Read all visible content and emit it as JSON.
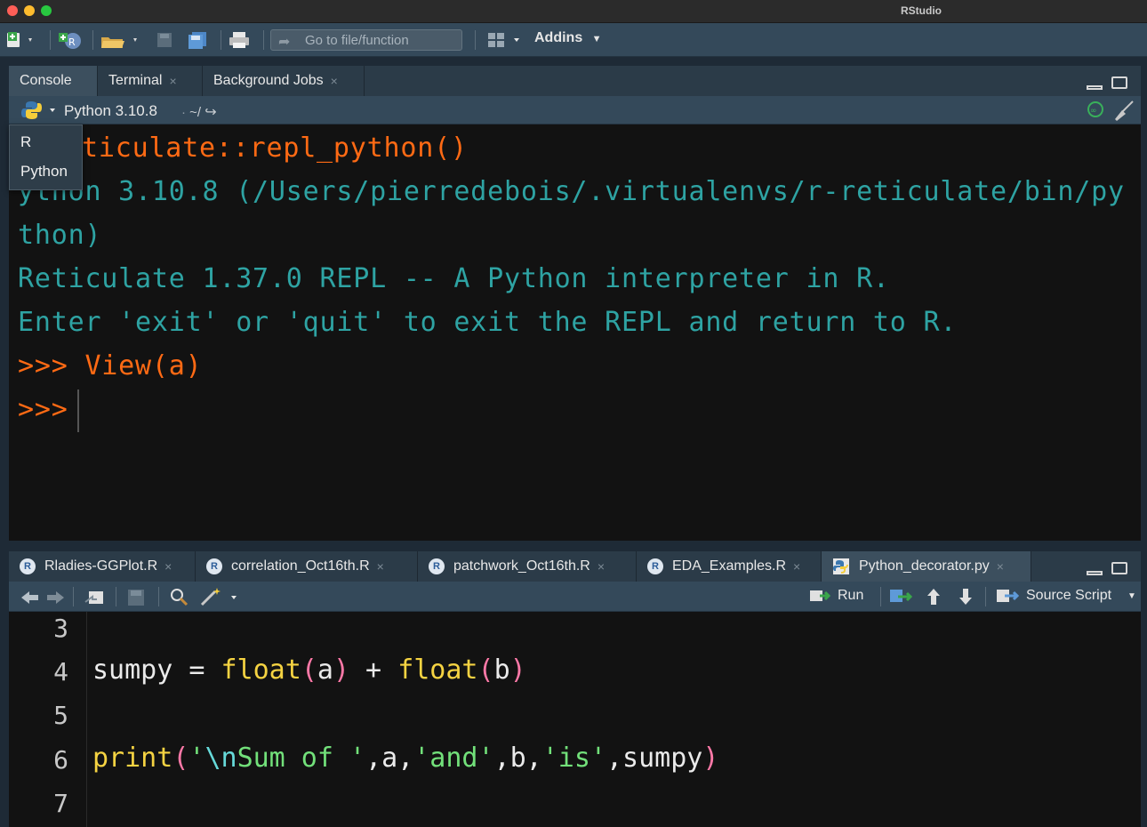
{
  "window": {
    "title": "RStudio"
  },
  "toolbar": {
    "goto_placeholder": "Go to file/function",
    "addins_label": "Addins"
  },
  "console_pane": {
    "tabs": [
      {
        "label": "Console",
        "active": true,
        "closable": false
      },
      {
        "label": "Terminal",
        "active": false,
        "closable": true
      },
      {
        "label": "Background Jobs",
        "active": false,
        "closable": true
      }
    ],
    "interpreter": "Python 3.10.8",
    "working_dir": "~/",
    "lines": [
      {
        "text": "ticulate::repl_python()",
        "color": "#ff6a14"
      },
      {
        "text": "ython 3.10.8 (/Users/pierredebois/.virtualenvs/r-reticulate/bin/py",
        "color": "#2ea3a3"
      },
      {
        "text": "thon)",
        "color": "#2ea3a3"
      },
      {
        "text": "Reticulate 1.37.0 REPL -- A Python interpreter in R.",
        "color": "#2ea3a3"
      },
      {
        "text": "Enter 'exit' or 'quit' to exit the REPL and return to R.",
        "color": "#2ea3a3"
      },
      {
        "text": ">>> View(a)",
        "color": "#ff6a14"
      },
      {
        "text": ">>>",
        "color": "#ff6a14"
      }
    ],
    "language_menu": [
      "R",
      "Python"
    ]
  },
  "editor_pane": {
    "tabs": [
      {
        "label": "Rladies-GGPlot.R",
        "type": "R",
        "active": false
      },
      {
        "label": "correlation_Oct16th.R",
        "type": "R",
        "active": false
      },
      {
        "label": "patchwork_Oct16th.R",
        "type": "R",
        "active": false
      },
      {
        "label": "EDA_Examples.R",
        "type": "R",
        "active": false
      },
      {
        "label": "Python_decorator.py",
        "type": "Python",
        "active": true
      }
    ],
    "run_label": "Run",
    "source_label": "Source Script",
    "line_numbers": [
      "3",
      "4",
      "5",
      "6",
      "7"
    ],
    "code": {
      "line4": {
        "a": "sumpy",
        "b": " = ",
        "c": "float",
        "d": "(",
        "e": "a",
        "f": ")",
        "g": " + ",
        "h": "float",
        "i": "(",
        "j": "b",
        "k": ")"
      },
      "line6": {
        "a": "print",
        "b": "(",
        "c": "'",
        "d": "\\n",
        "e": "Sum of '",
        "f": ",a,",
        "g": "'and'",
        "h": ",b,",
        "i": "'is'",
        "j": ",sumpy",
        "k": ")"
      }
    }
  },
  "colors": {
    "console_orange": "#ff6a14",
    "console_teal": "#2ea3a3",
    "toolbar_bg": "#34495a",
    "editor_bg": "#121212"
  }
}
